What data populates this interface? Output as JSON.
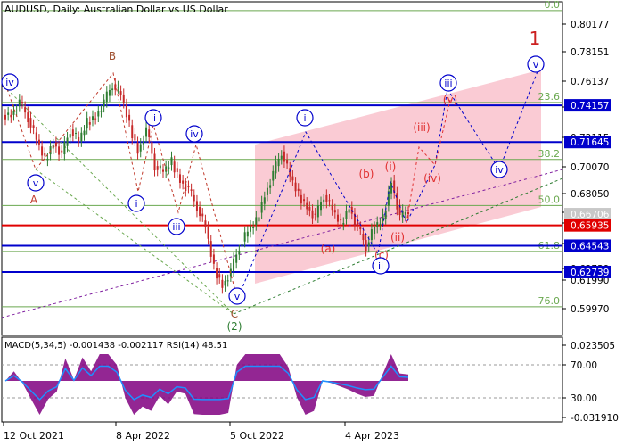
{
  "chart_data": {
    "type": "line",
    "title": "AUDUSD, Daily:  Australian Dollar vs US Dollar",
    "ylim": [
      0.584,
      0.8125
    ],
    "x_ticks": [
      "12 Oct 2021",
      "8 Apr 2022",
      "5 Oct 2022",
      "4 Apr 2023"
    ],
    "y_ticks": [
      "0.80177",
      "0.78151",
      "0.76137",
      "0.74157",
      "0.72115",
      "0.70070",
      "0.68050",
      "0.66706",
      "0.65935",
      "0.64543",
      "0.62739",
      "0.61990",
      "0.59970"
    ],
    "highlighted_ticks": [
      {
        "label": "0.74157",
        "color": "#0000cc"
      },
      {
        "label": "0.71645",
        "color": "#0000cc"
      },
      {
        "label": "0.66706",
        "color": "#c8c8c8"
      },
      {
        "label": "0.65935",
        "color": "#e00000"
      },
      {
        "label": "0.64543",
        "color": "#0000cc"
      },
      {
        "label": "0.62739",
        "color": "#0000cc"
      }
    ],
    "horizontal_levels": [
      {
        "value": 0.74157,
        "color": "#0000cc"
      },
      {
        "value": 0.71645,
        "color": "#0000cc"
      },
      {
        "value": 0.65935,
        "color": "#e00000"
      },
      {
        "value": 0.64543,
        "color": "#0000cc"
      },
      {
        "value": 0.62739,
        "color": "#0000cc"
      }
    ],
    "fibonacci_levels": [
      {
        "label": "0.0",
        "value": 0.8065
      },
      {
        "label": "23.6",
        "value": 0.7435
      },
      {
        "label": "38.2",
        "value": 0.7045
      },
      {
        "label": "50.0",
        "value": 0.673
      },
      {
        "label": "61.8",
        "value": 0.6415
      },
      {
        "label": "76.0",
        "value": 0.6036
      }
    ],
    "channel": {
      "color": "#f5a0b0"
    },
    "price_series": [
      0.735,
      0.744,
      0.733,
      0.718,
      0.704,
      0.716,
      0.708,
      0.725,
      0.717,
      0.73,
      0.734,
      0.744,
      0.756,
      0.749,
      0.728,
      0.71,
      0.725,
      0.7,
      0.696,
      0.703,
      0.69,
      0.684,
      0.672,
      0.658,
      0.63,
      0.618,
      0.628,
      0.645,
      0.655,
      0.662,
      0.68,
      0.695,
      0.71,
      0.693,
      0.68,
      0.672,
      0.665,
      0.68,
      0.67,
      0.66,
      0.672,
      0.658,
      0.645,
      0.658,
      0.664,
      0.69,
      0.665,
      0.67
    ],
    "wave_labels": [
      {
        "text": "iv",
        "circled": true,
        "color": "#0000cc"
      },
      {
        "text": "v",
        "circled": true,
        "color": "#0000cc"
      },
      {
        "text": "A",
        "circled": false,
        "color": "#c0392b"
      },
      {
        "text": "B",
        "circled": false,
        "color": "#a05030"
      },
      {
        "text": "ii",
        "circled": true,
        "color": "#0000cc"
      },
      {
        "text": "i",
        "circled": true,
        "color": "#0000cc"
      },
      {
        "text": "iv",
        "circled": true,
        "color": "#0000cc"
      },
      {
        "text": "iii",
        "circled": true,
        "color": "#0000cc"
      },
      {
        "text": "v",
        "circled": true,
        "color": "#0000cc"
      },
      {
        "text": "C",
        "circled": false,
        "color": "#a05030"
      },
      {
        "text": "(2)",
        "circled": false,
        "color": "#2e7d32"
      },
      {
        "text": "i",
        "circled": true,
        "color": "#0000cc"
      },
      {
        "text": "(a)",
        "circled": false,
        "color": "#e03030"
      },
      {
        "text": "(b)",
        "circled": false,
        "color": "#e03030"
      },
      {
        "text": "(c)",
        "circled": false,
        "color": "#e03030"
      },
      {
        "text": "ii",
        "circled": true,
        "color": "#0000cc"
      },
      {
        "text": "(i)",
        "circled": false,
        "color": "#e03030"
      },
      {
        "text": "(ii)",
        "circled": false,
        "color": "#e03030"
      },
      {
        "text": "(iii)",
        "circled": false,
        "color": "#e03030"
      },
      {
        "text": "(iv)",
        "circled": false,
        "color": "#e03030"
      },
      {
        "text": "(v)",
        "circled": false,
        "color": "#e03030"
      },
      {
        "text": "iii",
        "circled": true,
        "color": "#0000cc"
      },
      {
        "text": "iv",
        "circled": true,
        "color": "#0000cc"
      },
      {
        "text": "v",
        "circled": true,
        "color": "#0000cc"
      },
      {
        "text": "1",
        "circled": false,
        "color": "#cc2020"
      }
    ],
    "indicator": {
      "title": "MACD(5,34,5) -0.001438 -0.002117 RSI(14) 48.51",
      "y_ticks": [
        "0.023505",
        "70.00",
        "30.00",
        "-0.031910"
      ],
      "rsi_levels": [
        70,
        30
      ],
      "macd_color": "#800080",
      "rsi_color": "#1e90ff"
    }
  },
  "colors": {
    "axis": "#000000",
    "fib": "#6aa84f",
    "wave_blue": "#0000cc",
    "wave_red": "#e03030",
    "candle_up": "#2e7d32",
    "candle_down": "#c62828"
  }
}
